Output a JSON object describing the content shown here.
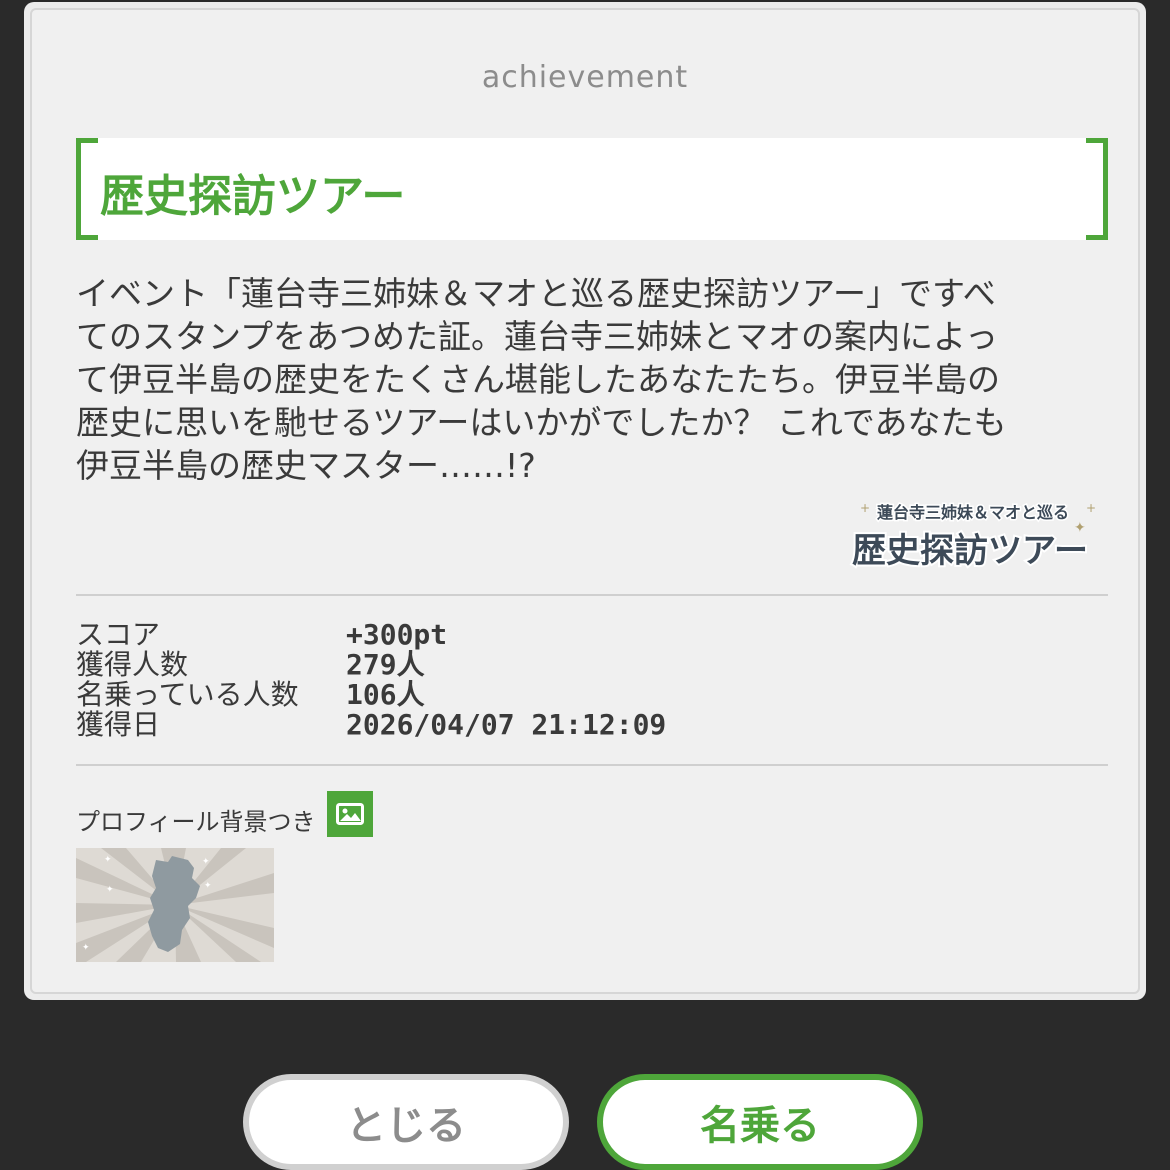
{
  "header": {
    "label": "achievement"
  },
  "achievement": {
    "title": "歴史探訪ツアー",
    "description_lines": [
      "イベント「蓮台寺三姉妹＆マオと巡る歴史探訪ツアー」ですべ",
      "てのスタンプをあつめた証。蓮台寺三姉妹とマオの案内によっ",
      "て伊豆半島の歴史をたくさん堪能したあなたたち。伊豆半島の",
      "歴史に思いを馳せるツアーはいかがでしたか？ これであなたも",
      "伊豆半島の歴史マスター……!?"
    ],
    "event_logo": {
      "top_text": "蓮台寺三姉妹＆マオと巡る",
      "main_text": "歴史探訪ツアー"
    }
  },
  "stats": [
    {
      "label": "スコア",
      "value": "+300pt"
    },
    {
      "label": "獲得人数",
      "value": "279人"
    },
    {
      "label": "名乗っている人数",
      "value": "106人"
    },
    {
      "label": "獲得日",
      "value": "2026/04/07 21:12:09"
    }
  ],
  "background": {
    "label": "プロフィール背景つき",
    "icon": "image-icon"
  },
  "buttons": {
    "close": "とじる",
    "claim": "名乗る"
  },
  "colors": {
    "accent": "#4ea63a",
    "page_bg": "#2a2a2a",
    "card_bg": "#f0f0f0",
    "text": "#3a3a3a",
    "muted": "#8c8c8c"
  }
}
